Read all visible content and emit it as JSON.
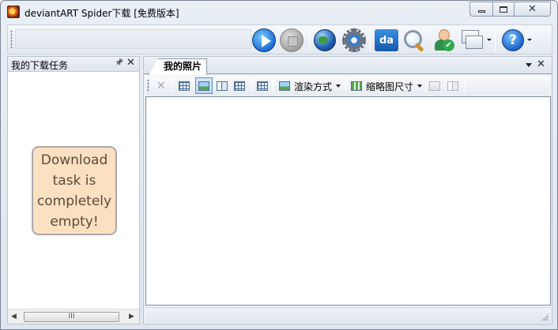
{
  "window": {
    "title": "deviantART Spider下载 [免费版本]",
    "controls": {
      "minimize": "",
      "maximize": "",
      "close": "✕"
    }
  },
  "toolbar": {
    "address_value": "",
    "buttons": [
      {
        "name": "play-button",
        "icon": "play-icon"
      },
      {
        "name": "stop-button",
        "icon": "stop-icon"
      },
      {
        "name": "globe-button",
        "icon": "globe-icon"
      },
      {
        "name": "settings-button",
        "icon": "gear-icon"
      },
      {
        "name": "deviantart-button",
        "icon": "deviantart-icon",
        "label": "da"
      },
      {
        "name": "search-button",
        "icon": "search-icon"
      },
      {
        "name": "user-button",
        "icon": "user-check-icon"
      },
      {
        "name": "windows-button",
        "icon": "windows-icon"
      },
      {
        "name": "help-button",
        "icon": "help-icon",
        "label": "?"
      }
    ]
  },
  "left_panel": {
    "title": "我的下载任务",
    "pin": "📌",
    "close": "✕",
    "empty_message": "Download task is completely empty!",
    "scrollbar": {
      "left_arrow": "◀",
      "thumb_grip": "III",
      "right_arrow": "▶"
    }
  },
  "right_panel": {
    "tab_label": "我的照片",
    "close": "✕",
    "sub_toolbar": {
      "delete": "✕",
      "render_mode_label": "渲染方式",
      "thumb_size_label": "缩略图尺寸"
    }
  },
  "colors": {
    "note_background": "#fbe0c1",
    "accent_blue": "#1a6fd0",
    "frame": "#dfe6ef"
  }
}
